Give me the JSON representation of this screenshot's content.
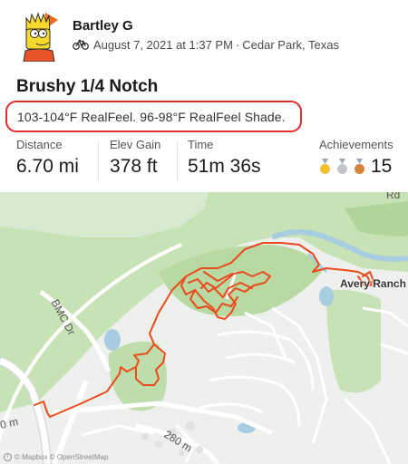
{
  "athlete": {
    "name": "Bartley G"
  },
  "activity": {
    "date": "August 7, 2021 at 1:37 PM",
    "location": "Cedar Park, Texas",
    "separator": "·",
    "title": "Brushy 1/4 Notch",
    "description": "103-104°F RealFeel. 96-98°F RealFeel Shade."
  },
  "stats": {
    "distance": {
      "label": "Distance",
      "value": "6.70 mi"
    },
    "elev_gain": {
      "label": "Elev Gain",
      "value": "378 ft"
    },
    "time": {
      "label": "Time",
      "value": "51m 36s"
    },
    "achievements": {
      "label": "Achievements",
      "value": "15"
    }
  },
  "map": {
    "labels": {
      "road_bmc": "BMC Dr",
      "road_280": "280 m",
      "road_50": "0 m",
      "road_rd": "Rd",
      "place": "Avery Ranch"
    },
    "attribution": "© Mapbox © OpenStreetMap"
  },
  "colors": {
    "route": "#ec4a1c",
    "highlight_box": "#e02d2d",
    "park_green": "#c7e2b4",
    "water": "#a9cde0"
  },
  "icons": {
    "activity_type": "bike-icon",
    "medals": [
      "gold-medal-icon",
      "silver-medal-icon",
      "bronze-medal-icon"
    ]
  }
}
